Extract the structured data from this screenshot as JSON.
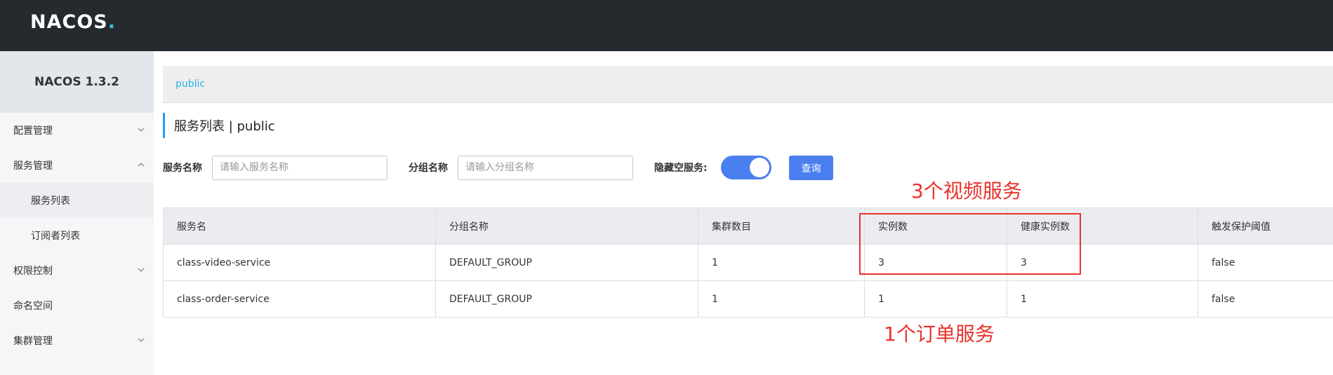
{
  "header": {
    "logo_main": "NAC",
    "logo_accent": "OS",
    "logo_dot": "."
  },
  "sidebar": {
    "version": "NACOS 1.3.2",
    "items": [
      {
        "label": "配置管理"
      },
      {
        "label": "服务管理"
      },
      {
        "label": "服务列表"
      },
      {
        "label": "订阅者列表"
      },
      {
        "label": "权限控制"
      },
      {
        "label": "命名空间"
      },
      {
        "label": "集群管理"
      }
    ]
  },
  "namespace": {
    "label": "public"
  },
  "page": {
    "title": "服务列表  |  public"
  },
  "filters": {
    "service_name_label": "服务名称",
    "service_name_placeholder": "请输入服务名称",
    "group_name_label": "分组名称",
    "group_name_placeholder": "请输入分组名称",
    "hide_empty_label": "隐藏空服务:",
    "hide_empty_on": true,
    "query_label": "查询"
  },
  "table": {
    "columns": [
      "服务名",
      "分组名称",
      "集群数目",
      "实例数",
      "健康实例数",
      "触发保护阈值"
    ],
    "rows": [
      [
        "class-video-service",
        "DEFAULT_GROUP",
        "1",
        "3",
        "3",
        "false"
      ],
      [
        "class-order-service",
        "DEFAULT_GROUP",
        "1",
        "1",
        "1",
        "false"
      ]
    ]
  },
  "annotations": {
    "top": "3个视频服务",
    "bottom": "1个订单服务",
    "color": "#e8322b"
  }
}
